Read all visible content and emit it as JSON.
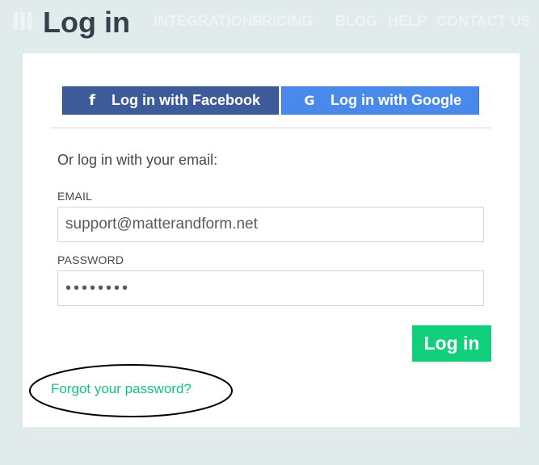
{
  "header": {
    "nav_items": [
      "INTEGRATIONS",
      "PRICING",
      "BLOG",
      "HELP",
      "CONTACT US"
    ],
    "page_title": "Log in"
  },
  "social": {
    "facebook_label": "Log in with Facebook",
    "google_label": "Log in with Google",
    "facebook_icon": "f",
    "google_icon": "G"
  },
  "form": {
    "or_text": "Or log in with your email:",
    "email_label": "EMAIL",
    "email_value": "support@matterandform.net",
    "password_label": "PASSWORD",
    "password_value": "••••••••",
    "submit_label": "Log in",
    "forgot_label": "Forgot your password?"
  },
  "colors": {
    "background": "#e1ebec",
    "facebook": "#3d5a99",
    "google": "#4a89ec",
    "accent": "#12cf7c"
  }
}
